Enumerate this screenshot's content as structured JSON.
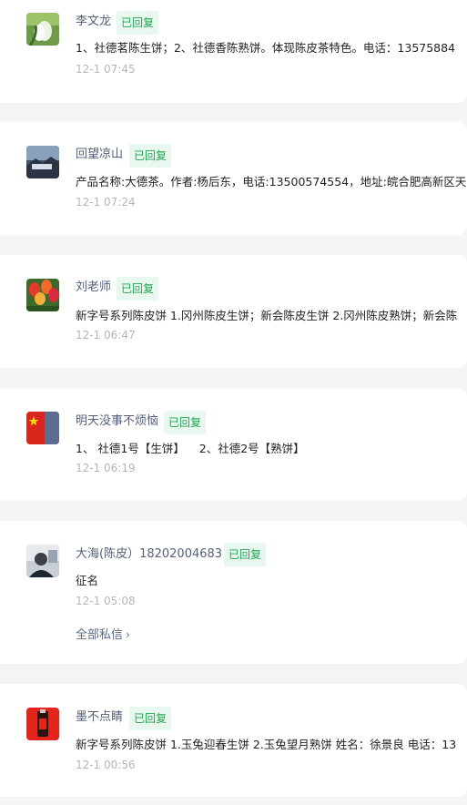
{
  "messages": [
    {
      "name": "李文龙",
      "badge": "已回复",
      "text": "1、社德茗陈生饼；2、社德香陈熟饼。体现陈皮茶特色。电话：13575884",
      "time": "12-1 07:45",
      "avatar_icon": "white-flower-avatar"
    },
    {
      "name": "回望凉山",
      "badge": "已回复",
      "text": "产品名称:大德茶。作者:杨后东，电话:13500574554，地址:皖合肥高新区天",
      "time": "12-1 07:24",
      "avatar_icon": "landscape-avatar"
    },
    {
      "name": "刘老师",
      "badge": "已回复",
      "text": "新字号系列陈皮饼 1.冈州陈皮生饼；新会陈皮生饼 2.冈州陈皮熟饼；新会陈",
      "time": "12-1 06:47",
      "avatar_icon": "tulips-avatar"
    },
    {
      "name": "明天没事不烦恼",
      "badge": "已回复",
      "text": "1、 社德1号【生饼】    2、社德2号【熟饼】",
      "time": "12-1 06:19",
      "avatar_icon": "red-flag-avatar"
    },
    {
      "name": "大海(陈皮）18202004683",
      "badge": "已回复",
      "text": "征名",
      "time": "12-1 05:08",
      "more": "全部私信",
      "avatar_icon": "person-avatar"
    },
    {
      "name": "墨不点睛",
      "badge": "已回复",
      "text": "新字号系列陈皮饼 1.玉兔迎春生饼 2.玉兔望月熟饼 姓名：徐景良 电话：13",
      "time": "12-1 00:56",
      "avatar_icon": "red-bottle-avatar"
    }
  ]
}
